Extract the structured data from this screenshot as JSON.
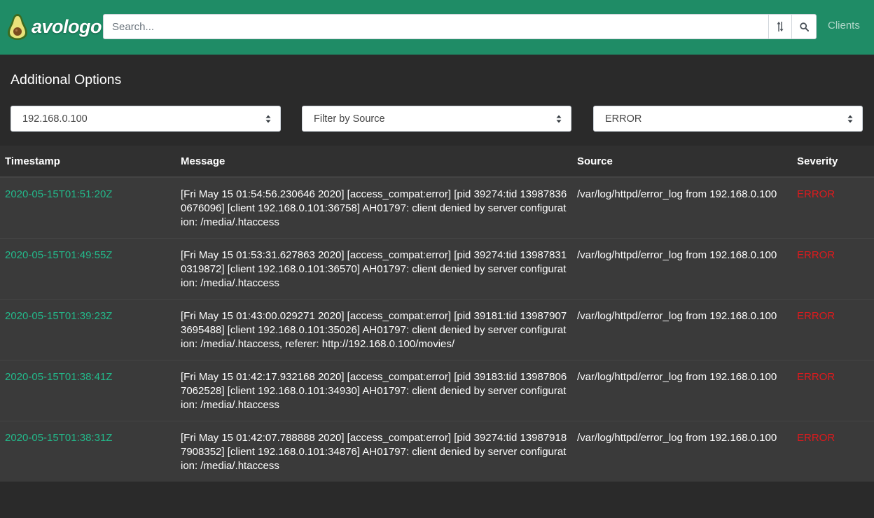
{
  "navbar": {
    "brand_name": "avologo",
    "search_placeholder": "Search...",
    "search_value": "",
    "sort_icon": "sort-arrows-icon",
    "search_icon": "magnifier-icon",
    "clients_link": "Clients",
    "brand_color": "#1f8c66"
  },
  "options": {
    "title": "Additional Options",
    "host_filter": "192.168.0.100",
    "source_filter": "Filter by Source",
    "severity_filter": "ERROR"
  },
  "table": {
    "headers": {
      "timestamp": "Timestamp",
      "message": "Message",
      "source": "Source",
      "severity": "Severity"
    },
    "rows": [
      {
        "timestamp": "2020-05-15T01:51:20Z",
        "message": "[Fri May 15 01:54:56.230646 2020] [access_compat:error] [pid 39274:tid 139878360676096] [client 192.168.0.101:36758] AH01797: client denied by server configuration: /media/.htaccess",
        "source": "/var/log/httpd/error_log from 192.168.0.100",
        "severity": "ERROR"
      },
      {
        "timestamp": "2020-05-15T01:49:55Z",
        "message": "[Fri May 15 01:53:31.627863 2020] [access_compat:error] [pid 39274:tid 139878310319872] [client 192.168.0.101:36570] AH01797: client denied by server configuration: /media/.htaccess",
        "source": "/var/log/httpd/error_log from 192.168.0.100",
        "severity": "ERROR"
      },
      {
        "timestamp": "2020-05-15T01:39:23Z",
        "message": "[Fri May 15 01:43:00.029271 2020] [access_compat:error] [pid 39181:tid 139879073695488] [client 192.168.0.101:35026] AH01797: client denied by server configuration: /media/.htaccess, referer: http://192.168.0.100/movies/",
        "source": "/var/log/httpd/error_log from 192.168.0.100",
        "severity": "ERROR"
      },
      {
        "timestamp": "2020-05-15T01:38:41Z",
        "message": "[Fri May 15 01:42:17.932168 2020] [access_compat:error] [pid 39183:tid 139878067062528] [client 192.168.0.101:34930] AH01797: client denied by server configuration: /media/.htaccess",
        "source": "/var/log/httpd/error_log from 192.168.0.100",
        "severity": "ERROR"
      },
      {
        "timestamp": "2020-05-15T01:38:31Z",
        "message": "[Fri May 15 01:42:07.788888 2020] [access_compat:error] [pid 39274:tid 139879187908352] [client 192.168.0.101:34876] AH01797: client denied by server configuration: /media/.htaccess",
        "source": "/var/log/httpd/error_log from 192.168.0.100",
        "severity": "ERROR"
      }
    ]
  }
}
